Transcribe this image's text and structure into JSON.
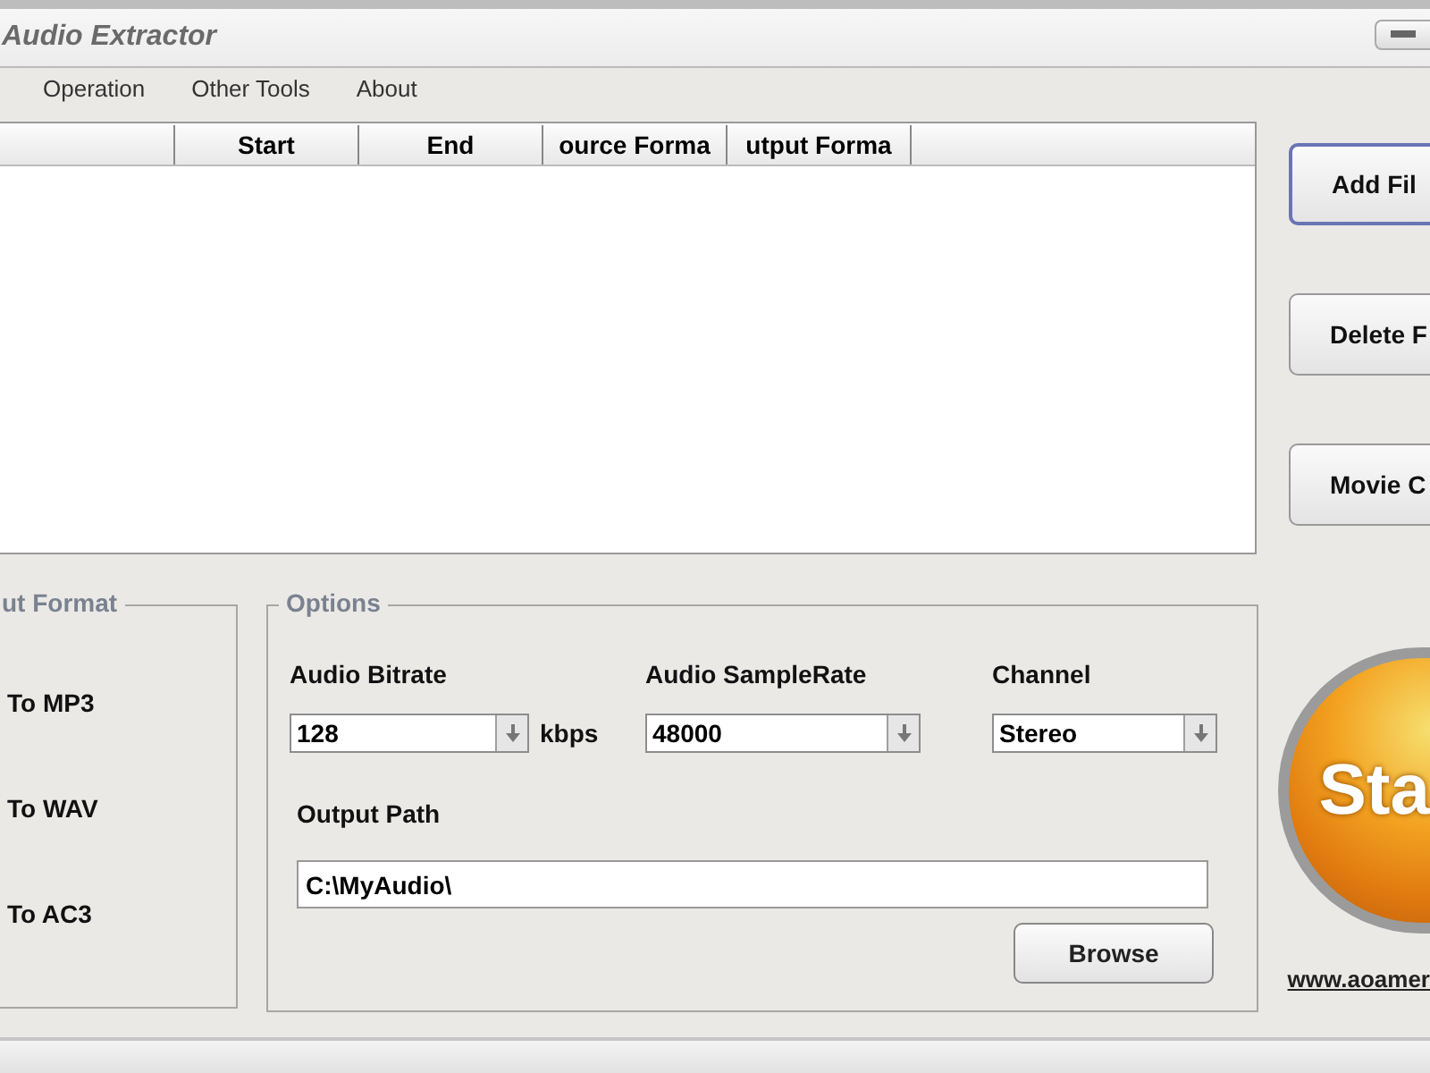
{
  "window": {
    "title": "Audio Extractor"
  },
  "menu": [
    "Operation",
    "Other Tools",
    "About"
  ],
  "file_list": {
    "columns": [
      "Start",
      "End",
      "ource Forma",
      "utput Forma"
    ]
  },
  "side_buttons": [
    "Add Fil",
    "Delete F",
    "Movie C"
  ],
  "output_format": {
    "title": "ut Format",
    "options": [
      "To MP3",
      "To WAV",
      "To AC3"
    ]
  },
  "options": {
    "title": "Options",
    "audio_bitrate": {
      "label": "Audio Bitrate",
      "value": "128",
      "unit": "kbps"
    },
    "sample_rate": {
      "label": "Audio SampleRate",
      "value": "48000"
    },
    "channel": {
      "label": "Channel",
      "value": "Stereo"
    },
    "output_path": {
      "label": "Output Path",
      "value": "C:\\MyAudio\\"
    },
    "browse_button": "Browse"
  },
  "start_button": "Sta",
  "website_link": "www.aoamer"
}
